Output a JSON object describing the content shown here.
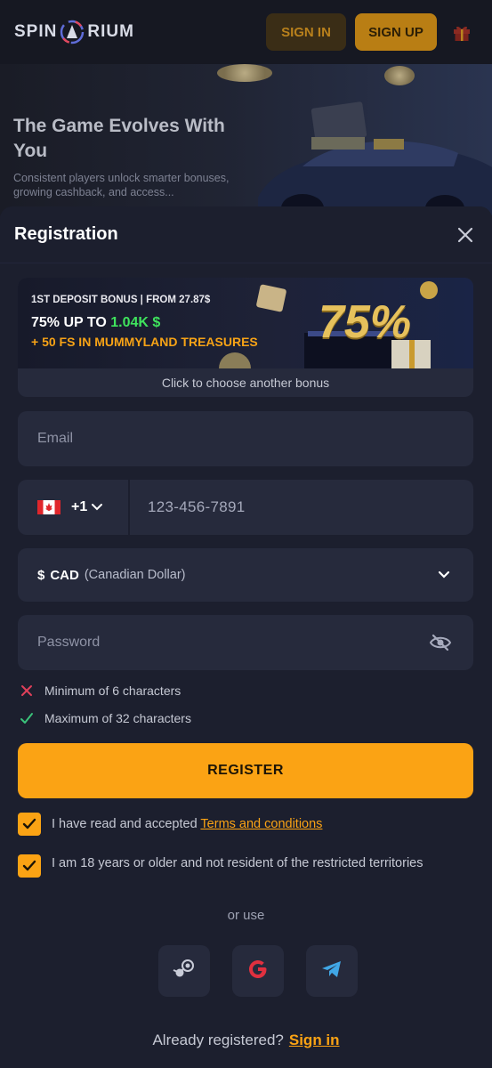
{
  "header": {
    "logo_left": "SPIN",
    "logo_right": "RIUM",
    "signin_label": "SIGN IN",
    "signup_label": "SIGN UP"
  },
  "hero": {
    "title": "The Game Evolves With You",
    "subtitle": "Consistent players unlock smarter bonuses, growing cashback, and access..."
  },
  "modal": {
    "title": "Registration"
  },
  "bonus": {
    "top_line": "1ST DEPOSIT BONUS | FROM 27.87$",
    "main_prefix": "75% UP TO ",
    "main_amount": "1.04K $",
    "free_spins": "+ 50 FS IN MUMMYLAND TREASURES",
    "percent_art": "75%",
    "choose_label": "Click to choose another bonus"
  },
  "form": {
    "email_placeholder": "Email",
    "phone_code": "+1",
    "phone_placeholder": "123-456-7891",
    "currency_symbol": "$",
    "currency_code": "CAD",
    "currency_name": "(Canadian Dollar)",
    "password_placeholder": "Password"
  },
  "rules": [
    {
      "text": "Minimum of 6 characters",
      "status": "fail",
      "color": "#e0405a"
    },
    {
      "text": "Maximum of 32 characters",
      "status": "pass",
      "color": "#3ac27a"
    }
  ],
  "register_label": "REGISTER",
  "checks": {
    "terms_text": "I have read and accepted ",
    "terms_link": "Terms and conditions",
    "age_text": "I am 18 years or older and not resident of the restricted territories"
  },
  "social": {
    "or_use": "or use",
    "icons": [
      "steam-icon",
      "google-icon",
      "telegram-icon"
    ]
  },
  "footer": {
    "already": "Already registered?",
    "signin_link": "Sign in"
  },
  "colors": {
    "accent": "#fba314",
    "bonus_amount": "#3fe35d",
    "background": "#1c1f2e",
    "field": "#262a3c"
  }
}
